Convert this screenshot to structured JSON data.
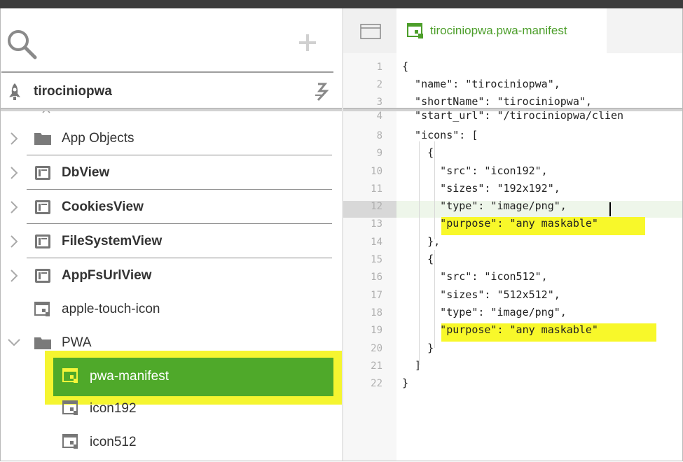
{
  "left": {
    "project_name": "tirociniopwa",
    "tree": [
      {
        "label": "App Objects",
        "icon": "folder-icon",
        "expandable": true,
        "bold": false
      },
      {
        "label": "DbView",
        "icon": "view-icon",
        "expandable": true,
        "bold": true
      },
      {
        "label": "CookiesView",
        "icon": "view-icon",
        "expandable": true,
        "bold": true
      },
      {
        "label": "FileSystemView",
        "icon": "view-icon",
        "expandable": true,
        "bold": true
      },
      {
        "label": "AppFsUrlView",
        "icon": "view-icon",
        "expandable": true,
        "bold": true
      },
      {
        "label": "apple-touch-icon",
        "icon": "resource-icon",
        "expandable": false,
        "bold": false
      },
      {
        "label": "PWA",
        "icon": "folder-icon",
        "expandable": true,
        "expanded": true,
        "bold": false
      }
    ],
    "pwa_children": [
      {
        "label": "pwa-manifest",
        "selected": true
      },
      {
        "label": "icon192",
        "selected": false
      },
      {
        "label": "icon512",
        "selected": false
      }
    ]
  },
  "editor": {
    "tab_label": "tirociniopwa.pwa-manifest",
    "lines": [
      {
        "n": "1",
        "text": "{"
      },
      {
        "n": "2",
        "text": "  \"name\": \"tirociniopwa\","
      },
      {
        "n": "3",
        "text": "  \"shortName\": \"tirociniopwa\","
      },
      {
        "n": "4",
        "text": "  \"start_url\": \"/tirociniopwa/clien"
      },
      {
        "n": "8",
        "text": "  \"icons\": ["
      },
      {
        "n": "9",
        "text": "    {"
      },
      {
        "n": "10",
        "text": "      \"src\": \"icon192\","
      },
      {
        "n": "11",
        "text": "      \"sizes\": \"192x192\","
      },
      {
        "n": "12",
        "text": "      \"type\": \"image/png\","
      },
      {
        "n": "13",
        "text": "      \"purpose\": \"any maskable\""
      },
      {
        "n": "14",
        "text": "    },"
      },
      {
        "n": "15",
        "text": "    {"
      },
      {
        "n": "16",
        "text": "      \"src\": \"icon512\","
      },
      {
        "n": "17",
        "text": "      \"sizes\": \"512x512\","
      },
      {
        "n": "18",
        "text": "      \"type\": \"image/png\","
      },
      {
        "n": "19",
        "text": "      \"purpose\": \"any maskable\""
      },
      {
        "n": "20",
        "text": "    }"
      },
      {
        "n": "21",
        "text": "  ]"
      },
      {
        "n": "22",
        "text": "}"
      }
    ]
  },
  "colors": {
    "selection_green": "#4fa92a",
    "highlight_yellow": "#f8f82a",
    "tab_green": "#4c9e2a"
  }
}
